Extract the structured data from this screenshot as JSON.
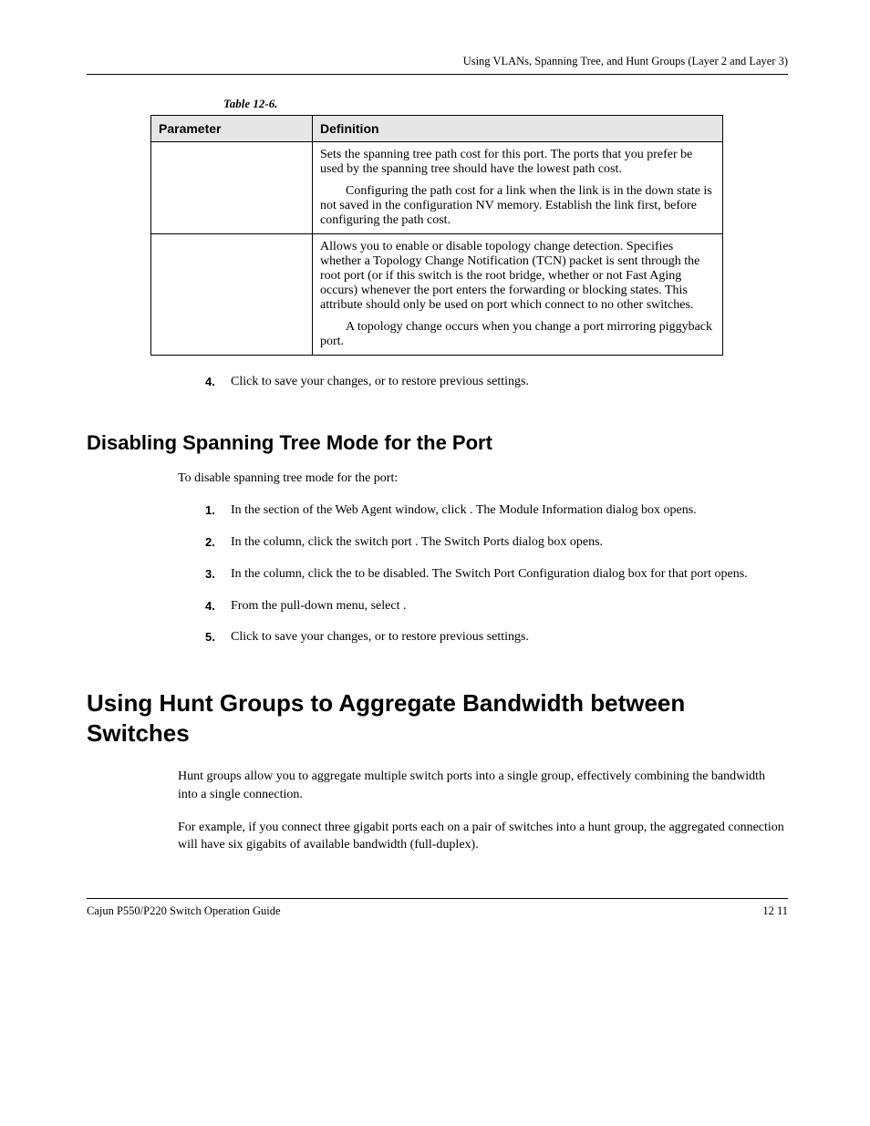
{
  "header": {
    "right": "Using VLANs, Spanning Tree, and Hunt Groups (Layer 2 and Layer 3)"
  },
  "table": {
    "caption": "Table 12-6.",
    "headers": {
      "param": "Parameter",
      "def": "Definition"
    },
    "rows": [
      {
        "definition": "Sets the spanning tree path cost for this port. The ports that you prefer be used by the spanning tree should have the lowest path cost.",
        "note": "Configuring the path cost for a link when the link is in the down state is not saved in the configuration NV memory. Establish the link first, before configuring the path cost."
      },
      {
        "definition": "Allows you to enable or disable topology change detection. Specifies whether a Topology Change Notification (TCN) packet is sent through the root port (or if this switch is the root bridge, whether or not Fast Aging occurs) whenever the port enters the forwarding or blocking states. This attribute should only be used on port which connect to no other switches.",
        "note": "A topology change occurs when you change a port mirroring piggyback port."
      }
    ]
  },
  "step4": {
    "text": "Click             to save your changes, or               to restore previous settings."
  },
  "section1": {
    "title": "Disabling Spanning Tree Mode for the Port",
    "intro": "To disable spanning tree mode for the port:",
    "steps": [
      "In the                                                      section of the Web Agent window, click                . The Module Information dialog box opens.",
      "In the                       column, click the switch port                     . The Switch Ports dialog box opens.",
      "In the              column, click the                               to be disabled. The Switch Port Configuration dialog box for that port opens.",
      "From the                                       pull-down menu, select              .",
      "Click              to save your changes, or                  to restore previous settings."
    ]
  },
  "section2": {
    "title": "Using Hunt Groups to Aggregate Bandwidth between Switches",
    "p1": "Hunt groups allow you to aggregate multiple switch ports into a single group, effectively combining the bandwidth into a single connection.",
    "p2": "For example, if you connect three gigabit ports each on a pair of switches into a hunt group, the aggregated connection will have six gigabits of available bandwidth (full-duplex)."
  },
  "footer": {
    "left": "Cajun P550/P220 Switch Operation Guide",
    "right": "12 11"
  }
}
